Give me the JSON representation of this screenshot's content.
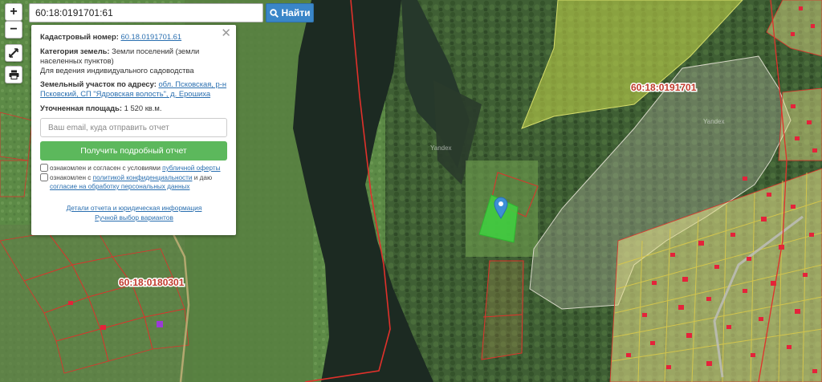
{
  "search": {
    "value": "60:18:0191701:61",
    "button_label": "Найти",
    "icon": "search-icon"
  },
  "tools": {
    "zoom_in_label": "+",
    "zoom_out_label": "−",
    "measure_icon": "ruler-icon",
    "print_icon": "printer-icon"
  },
  "info": {
    "cadastral_label": "Кадастровый номер:",
    "cadastral_value": "60.18.0191701.61",
    "category_label": "Категория земель:",
    "category_value": "Земли поселений (земли населенных пунктов)",
    "usage_value": "Для ведения индивидуального садоводства",
    "address_label": "Земельный участок по адресу:",
    "address_value": "обл. Псковская, р-н Псковский, СП \"Ядровская волость\", д. Ерошиха",
    "area_label": "Уточненная площадь:",
    "area_value": "1 520 кв.м.",
    "email_placeholder": "Ваш email, куда отправить отчет",
    "report_button": "Получить подробный отчет",
    "consent1_text": "ознакомлен и согласен с условиями",
    "consent1_link": "публичной оферты",
    "consent2_text": "ознакомлен с",
    "consent2_link1": "политикой конфиденциальности",
    "consent2_mid": "и даю",
    "consent2_link2": "согласие на обработку персональных данных",
    "details_link": "Детали отчета и юридическая информация",
    "manual_link": "Ручной выбор вариантов",
    "close_icon": "close-icon"
  },
  "map": {
    "labels": [
      "60:18:0191701",
      "60:18:0180301"
    ],
    "watermarks": [
      "Yandex",
      "Yandex"
    ],
    "marker_icon": "location-pin-icon",
    "colors": {
      "parcel_border": "#e0312b",
      "selected_fill": "#3fd13f",
      "zone_fill": "#c9d94a",
      "river": "#1c2a22"
    }
  }
}
